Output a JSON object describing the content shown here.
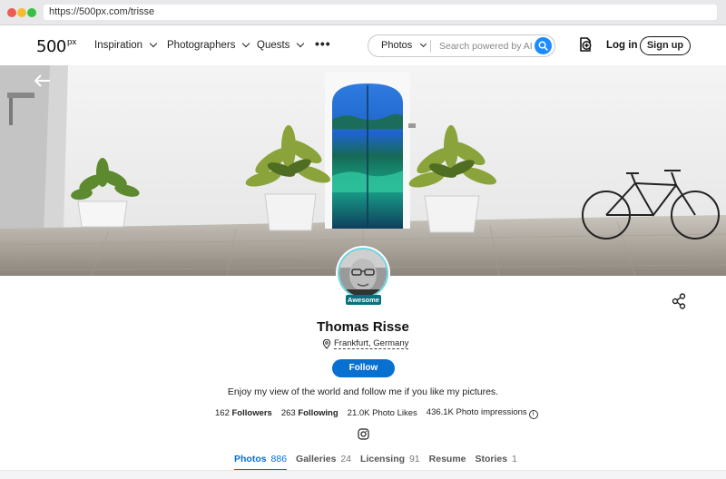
{
  "browser": {
    "url": "https://500px.com/trisse"
  },
  "nav": {
    "logo": "500",
    "logo_sup": "px",
    "links": [
      {
        "label": "Inspiration"
      },
      {
        "label": "Photographers"
      },
      {
        "label": "Quests"
      }
    ],
    "more_label": "•••",
    "search": {
      "scope": "Photos",
      "placeholder": "Search powered by AI"
    },
    "login_label": "Log in",
    "signup_label": "Sign up"
  },
  "profile": {
    "name": "Thomas Risse",
    "badge": "Awesome",
    "location": "Frankfurt, Germany",
    "follow_label": "Follow",
    "bio": "Enjoy my view of the world and follow me if you like my pictures.",
    "stats": {
      "followers_count": "162",
      "followers_label": "Followers",
      "following_count": "263",
      "following_label": "Following",
      "likes": "21.0K Photo Likes",
      "impressions": "436.1K Photo impressions",
      "info_glyph": "i"
    }
  },
  "tabs": [
    {
      "label": "Photos",
      "count": "886",
      "active": true
    },
    {
      "label": "Galleries",
      "count": "24"
    },
    {
      "label": "Licensing",
      "count": "91"
    },
    {
      "label": "Resume",
      "count": ""
    },
    {
      "label": "Stories",
      "count": "1"
    }
  ],
  "colors": {
    "accent": "#0870d1",
    "badge": "#07717e",
    "search_button": "#1a8cff"
  },
  "icons": [
    "back-arrow-icon",
    "search-icon",
    "upload-icon",
    "share-icon",
    "location-pin-icon",
    "instagram-icon",
    "info-icon"
  ]
}
